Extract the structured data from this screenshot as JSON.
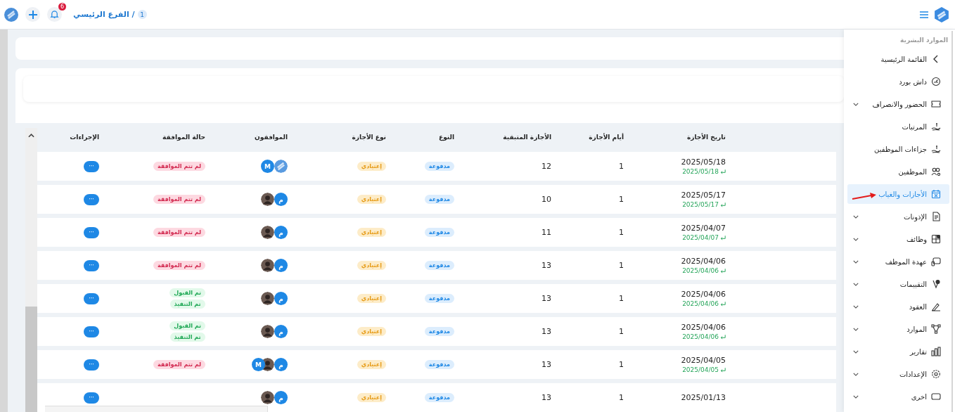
{
  "topbar": {
    "notifications": "6",
    "branch_number": "1",
    "branch": "الفرع الرئيسي /"
  },
  "sidebar": {
    "section": "الموارد البشرية",
    "items": [
      {
        "label": "القائمة الرئيسية",
        "expandable": false,
        "selected": false
      },
      {
        "label": "داش بورد",
        "expandable": false,
        "selected": false
      },
      {
        "label": "الحضور والانصراف",
        "expandable": true,
        "selected": false
      },
      {
        "label": "المرتبات",
        "expandable": false,
        "selected": false
      },
      {
        "label": "جزاءات الموظفين",
        "expandable": false,
        "selected": false
      },
      {
        "label": "الموظفين",
        "expandable": false,
        "selected": false
      },
      {
        "label": "الأجازات والغياب",
        "expandable": false,
        "selected": true,
        "pointer": true
      },
      {
        "label": "الإذونات",
        "expandable": true,
        "selected": false
      },
      {
        "label": "وظائف",
        "expandable": true,
        "selected": false
      },
      {
        "label": "عهدة الموظف",
        "expandable": true,
        "selected": false
      },
      {
        "label": "التقييمات",
        "expandable": true,
        "selected": false
      },
      {
        "label": "العقود",
        "expandable": true,
        "selected": false
      },
      {
        "label": "الموارد",
        "expandable": true,
        "selected": false
      },
      {
        "label": "تقارير",
        "expandable": true,
        "selected": false
      },
      {
        "label": "الإعدادات",
        "expandable": true,
        "selected": false
      },
      {
        "label": "اخرى",
        "expandable": true,
        "selected": false
      }
    ]
  },
  "table": {
    "columns": [
      "تاريخ الأجازة",
      "أيام الأجازة",
      "الأجازة المتبقية",
      "النوع",
      "نوع الأجازة",
      "الموافقون",
      "حالة الموافقة",
      "الإجراءات"
    ],
    "rows": [
      {
        "date": "2025/05/18",
        "end_date": "2025/05/18",
        "days": "1",
        "remaining": "12",
        "type": "مدفوعة",
        "leave_type": "إعتيادي",
        "approvers": [
          {
            "kind": "logo"
          },
          {
            "kind": "letter",
            "text": "M"
          }
        ],
        "status": [
          {
            "kind": "pending",
            "text": "لم تتم الموافقة"
          }
        ],
        "action": "···"
      },
      {
        "date": "2025/05/17",
        "end_date": "2025/05/17",
        "days": "1",
        "remaining": "10",
        "type": "مدفوعة",
        "leave_type": "إعتيادي",
        "approvers": [
          {
            "kind": "letter",
            "text": "م"
          },
          {
            "kind": "photo"
          }
        ],
        "status": [
          {
            "kind": "pending",
            "text": "لم تتم الموافقة"
          }
        ],
        "action": "···"
      },
      {
        "date": "2025/04/07",
        "end_date": "2025/04/07",
        "days": "1",
        "remaining": "11",
        "type": "مدفوعة",
        "leave_type": "إعتيادي",
        "approvers": [
          {
            "kind": "letter",
            "text": "م"
          },
          {
            "kind": "photo"
          }
        ],
        "status": [
          {
            "kind": "pending",
            "text": "لم تتم الموافقة"
          }
        ],
        "action": "···"
      },
      {
        "date": "2025/04/06",
        "end_date": "2025/04/06",
        "days": "1",
        "remaining": "13",
        "type": "مدفوعة",
        "leave_type": "إعتيادي",
        "approvers": [
          {
            "kind": "letter",
            "text": "م"
          },
          {
            "kind": "photo"
          }
        ],
        "status": [
          {
            "kind": "pending",
            "text": "لم تتم الموافقة"
          }
        ],
        "action": "···"
      },
      {
        "date": "2025/04/06",
        "end_date": "2025/04/06",
        "days": "1",
        "remaining": "13",
        "type": "مدفوعة",
        "leave_type": "إعتيادي",
        "approvers": [
          {
            "kind": "letter",
            "text": "م"
          },
          {
            "kind": "photo"
          }
        ],
        "status": [
          {
            "kind": "approved",
            "text": "تم القبول"
          },
          {
            "kind": "approved",
            "text": "تم التنفيذ"
          }
        ],
        "action": "···"
      },
      {
        "date": "2025/04/06",
        "end_date": "2025/04/06",
        "days": "1",
        "remaining": "13",
        "type": "مدفوعة",
        "leave_type": "إعتيادي",
        "approvers": [
          {
            "kind": "letter",
            "text": "م"
          },
          {
            "kind": "photo"
          }
        ],
        "status": [
          {
            "kind": "approved",
            "text": "تم القبول"
          },
          {
            "kind": "approved",
            "text": "تم التنفيذ"
          }
        ],
        "action": "···"
      },
      {
        "date": "2025/04/05",
        "end_date": "2025/04/05",
        "days": "1",
        "remaining": "13",
        "type": "مدفوعة",
        "leave_type": "إعتيادي",
        "approvers": [
          {
            "kind": "letter",
            "text": "م"
          },
          {
            "kind": "photo"
          },
          {
            "kind": "letter",
            "text": "M"
          }
        ],
        "status": [
          {
            "kind": "pending",
            "text": "لم تتم الموافقة"
          }
        ],
        "action": "···"
      },
      {
        "date": "2025/01/13",
        "days": "1",
        "remaining": "13",
        "type": "مدفوعة",
        "leave_type": "إعتيادي",
        "approvers": [
          {
            "kind": "letter",
            "text": "م"
          },
          {
            "kind": "photo"
          }
        ],
        "status": [],
        "action": "···"
      }
    ]
  }
}
